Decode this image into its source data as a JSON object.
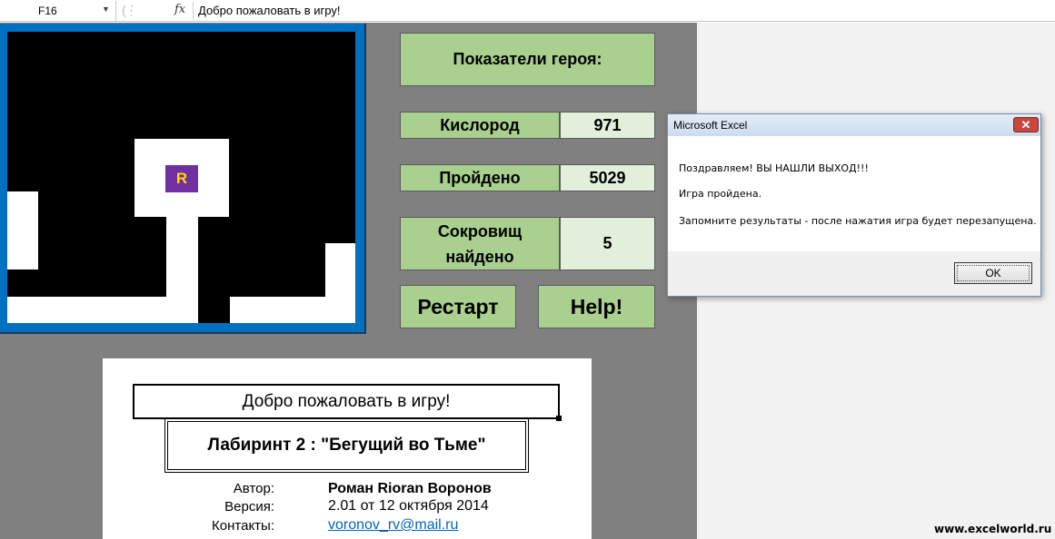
{
  "formula_bar": {
    "name_box": "F16",
    "fx_symbol": "fx",
    "formula": "Добро пожаловать в игру!"
  },
  "maze": {
    "hero_marker": "R",
    "colors": {
      "wall": "#000000",
      "path": "#ffffff",
      "hero": "#7030a0",
      "frame": "#0070c0"
    }
  },
  "hero_stats": {
    "title": "Показатели героя:",
    "oxygen_label": "Кислород",
    "oxygen_value": "971",
    "passed_label": "Пройдено",
    "passed_value": "5029",
    "treasure_label_line1": "Сокровищ",
    "treasure_label_line2": "найдено",
    "treasure_value": "5"
  },
  "buttons": {
    "restart": "Рестарт",
    "help": "Help!"
  },
  "info": {
    "welcome": "Добро пожаловать в игру!",
    "game_title": "Лабиринт 2 : \"Бегущий во Тьме\"",
    "author_label": "Автор:",
    "author_value": "Роман Rioran Воронов",
    "version_label": "Версия:",
    "version_value": "2.01 от 12 октября 2014",
    "contacts_label": "Контакты:",
    "contacts_value": "voronov_rv@mail.ru"
  },
  "dialog": {
    "title": "Microsoft Excel",
    "line1": "Поздравляем! ВЫ НАШЛИ ВЫХОД!!!",
    "line2": "Игра пройдена.",
    "line3": "Запомните результаты - после нажатия игра будет перезапущена.",
    "ok": "OK",
    "close_symbol": "✕"
  },
  "watermark": "www.excelworld.ru",
  "colors": {
    "stat_label_bg": "#a9d08e",
    "stat_value_bg": "#e2efda",
    "sheet_bg": "#808080",
    "link": "#0563c1"
  }
}
